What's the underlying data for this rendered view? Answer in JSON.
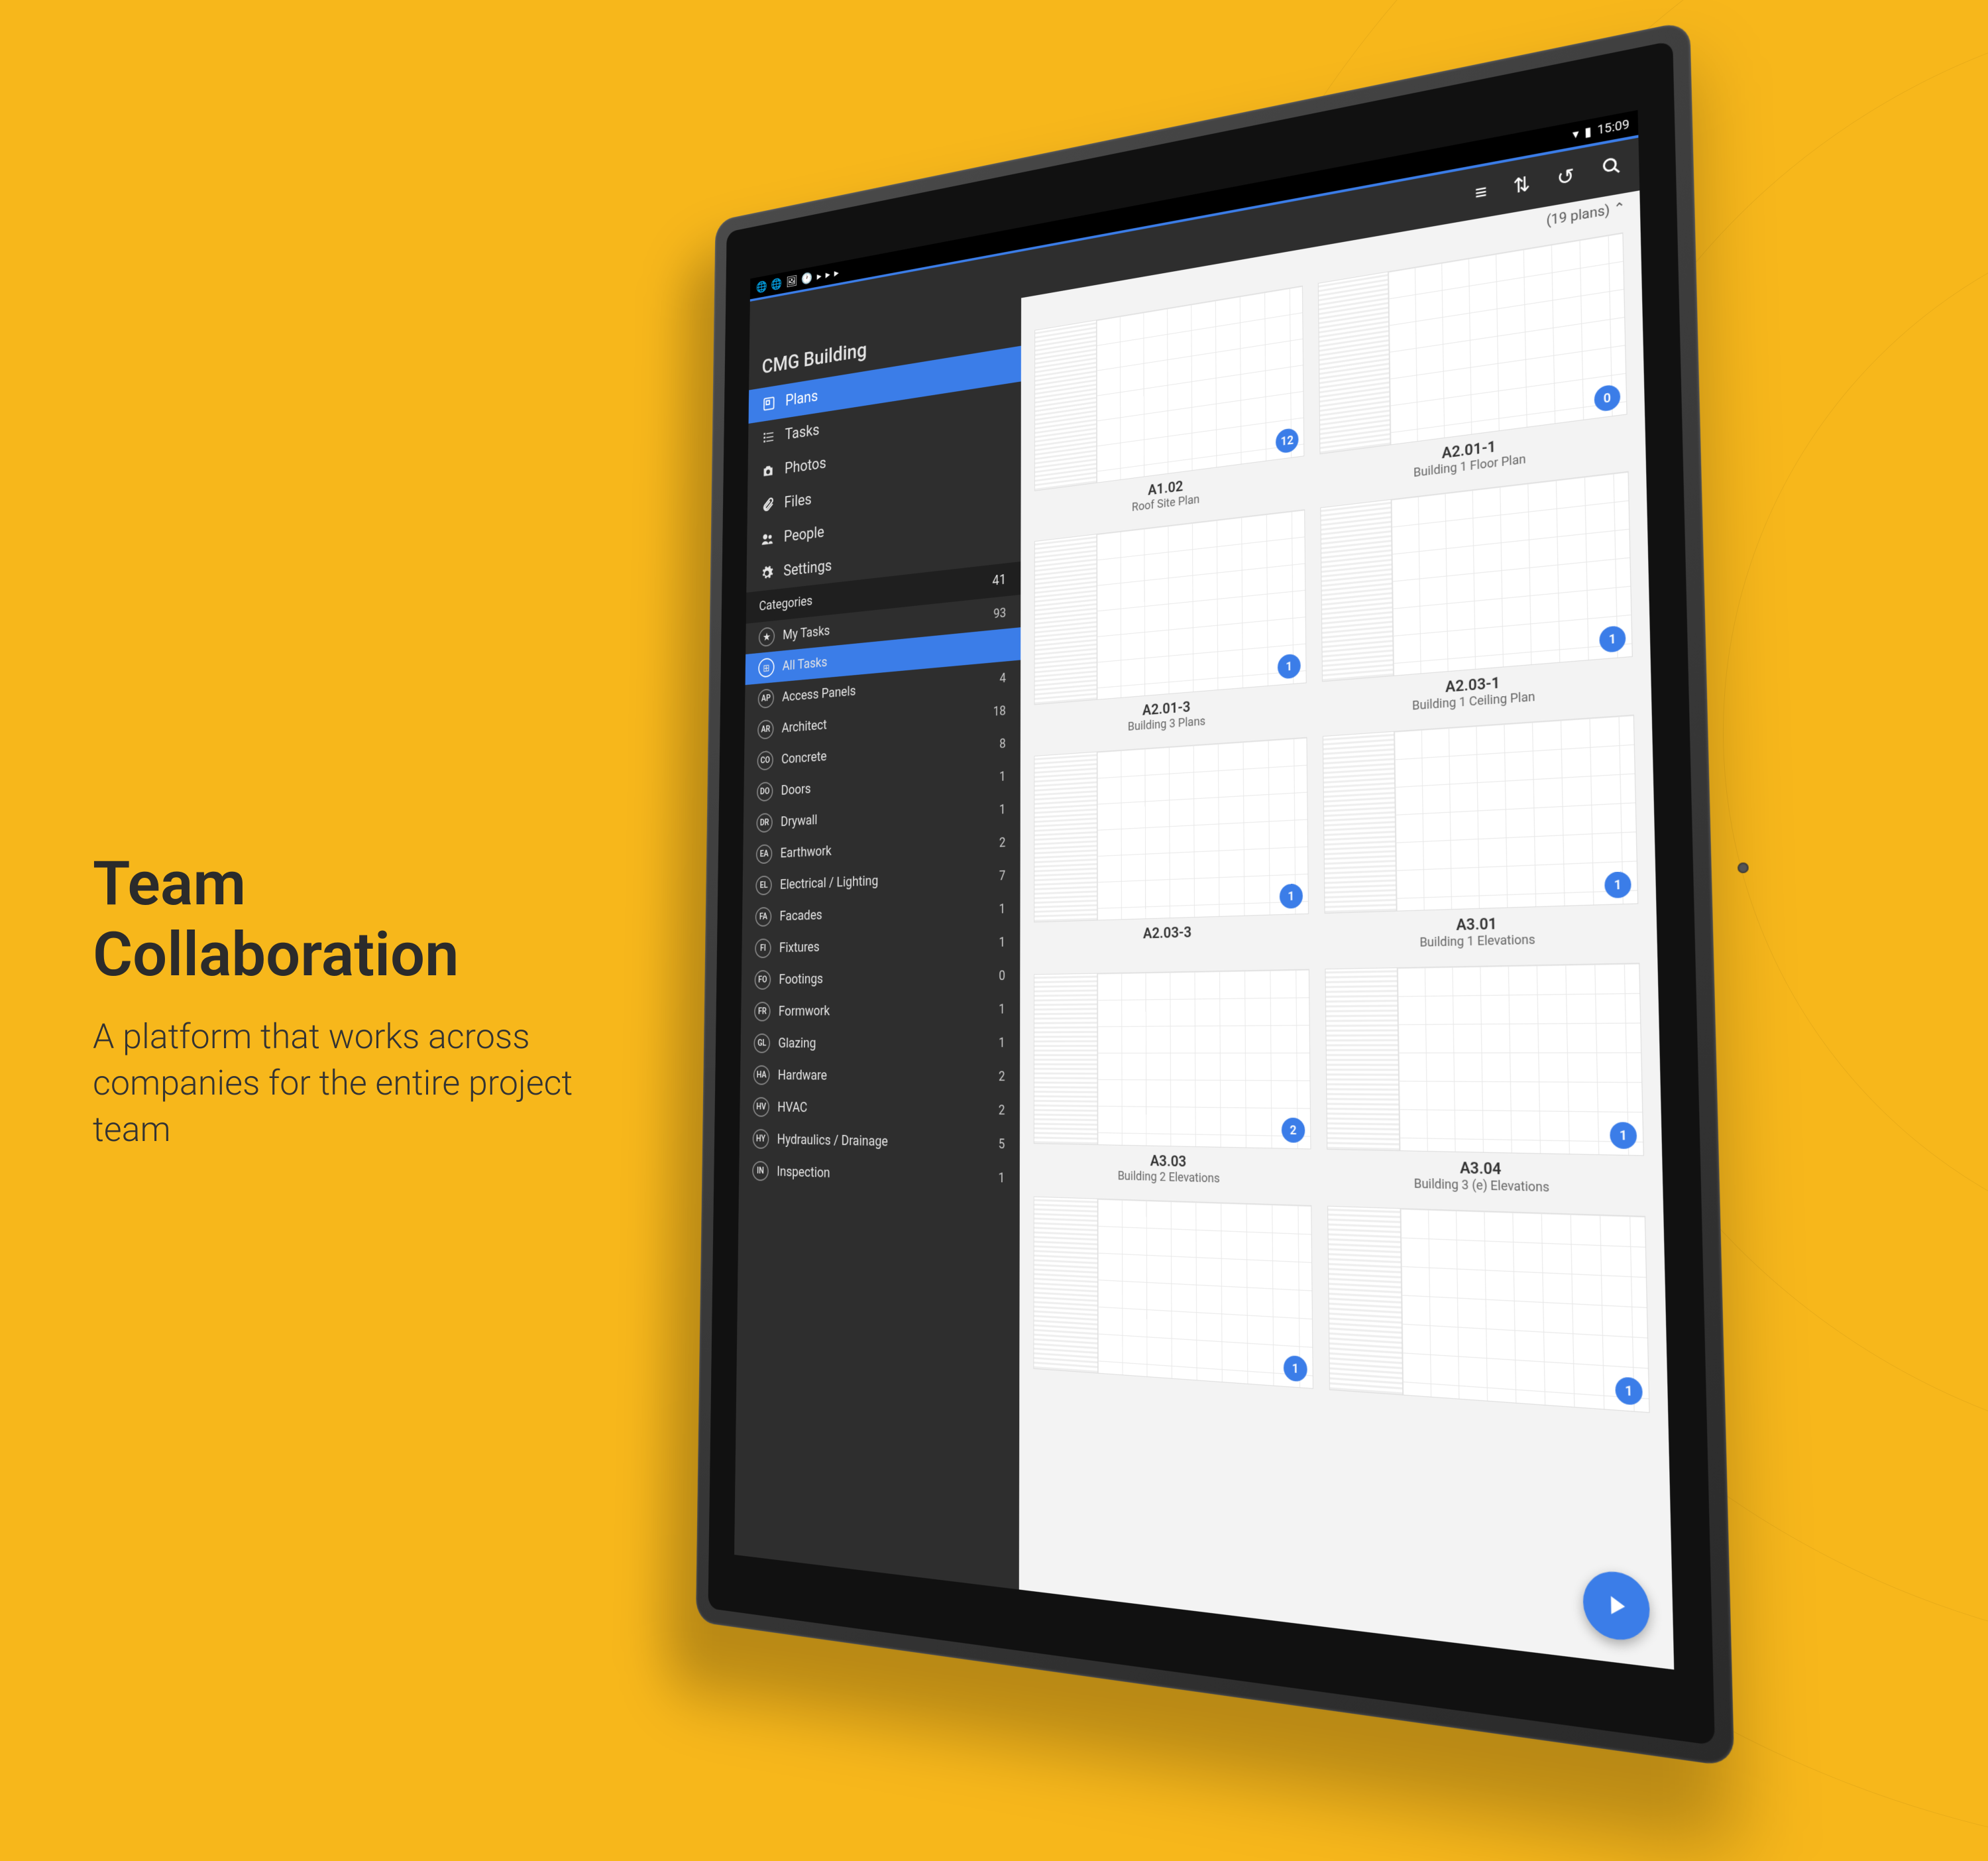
{
  "marketing": {
    "title": "Team Collaboration",
    "subtitle": "A platform that works across companies for the entire project team"
  },
  "status": {
    "time": "15:09"
  },
  "project": {
    "title": "CMG Building"
  },
  "nav": [
    {
      "label": "Plans",
      "icon": "plans",
      "active": true
    },
    {
      "label": "Tasks",
      "icon": "tasks",
      "active": false
    },
    {
      "label": "Photos",
      "icon": "photos",
      "active": false
    },
    {
      "label": "Files",
      "icon": "files",
      "active": false
    },
    {
      "label": "People",
      "icon": "people",
      "active": false
    },
    {
      "label": "Settings",
      "icon": "settings",
      "active": false
    }
  ],
  "categories": {
    "header": "Categories",
    "headerCount": "41",
    "items": [
      {
        "code": "★",
        "label": "My Tasks",
        "count": "93",
        "star": true,
        "active": false
      },
      {
        "code": "⊞",
        "label": "All Tasks",
        "count": "",
        "grid": true,
        "active": true
      },
      {
        "code": "AP",
        "label": "Access Panels",
        "count": "4"
      },
      {
        "code": "AR",
        "label": "Architect",
        "count": "18"
      },
      {
        "code": "CO",
        "label": "Concrete",
        "count": "8"
      },
      {
        "code": "DO",
        "label": "Doors",
        "count": "1"
      },
      {
        "code": "DR",
        "label": "Drywall",
        "count": "1"
      },
      {
        "code": "EA",
        "label": "Earthwork",
        "count": "2"
      },
      {
        "code": "EL",
        "label": "Electrical / Lighting",
        "count": "7"
      },
      {
        "code": "FA",
        "label": "Facades",
        "count": "1"
      },
      {
        "code": "FI",
        "label": "Fixtures",
        "count": "1"
      },
      {
        "code": "FO",
        "label": "Footings",
        "count": "0"
      },
      {
        "code": "FR",
        "label": "Formwork",
        "count": "1"
      },
      {
        "code": "GL",
        "label": "Glazing",
        "count": "1"
      },
      {
        "code": "HA",
        "label": "Hardware",
        "count": "2"
      },
      {
        "code": "HV",
        "label": "HVAC",
        "count": "2"
      },
      {
        "code": "HY",
        "label": "Hydraulics / Drainage",
        "count": "5"
      },
      {
        "code": "IN",
        "label": "Inspection",
        "count": "1"
      }
    ]
  },
  "plans": {
    "header": "(19 plans)",
    "items": [
      {
        "code": "A1.02",
        "name": "Roof Site Plan",
        "badge": "12"
      },
      {
        "code": "A2.01-1",
        "name": "Building 1 Floor Plan",
        "badge": "0"
      },
      {
        "code": "A2.01-3",
        "name": "Building 3 Plans",
        "badge": "1"
      },
      {
        "code": "A2.03-1",
        "name": "Building 1 Ceiling Plan",
        "badge": "1"
      },
      {
        "code": "A2.03-3",
        "name": "",
        "badge": "1"
      },
      {
        "code": "A3.01",
        "name": "Building 1 Elevations",
        "badge": "1"
      },
      {
        "code": "A3.03",
        "name": "Building 2 Elevations",
        "badge": "2"
      },
      {
        "code": "A3.04",
        "name": "Building 3 (e) Elevations",
        "badge": "1"
      },
      {
        "code": "",
        "name": "",
        "badge": "1"
      },
      {
        "code": "",
        "name": "",
        "badge": "1"
      }
    ]
  }
}
